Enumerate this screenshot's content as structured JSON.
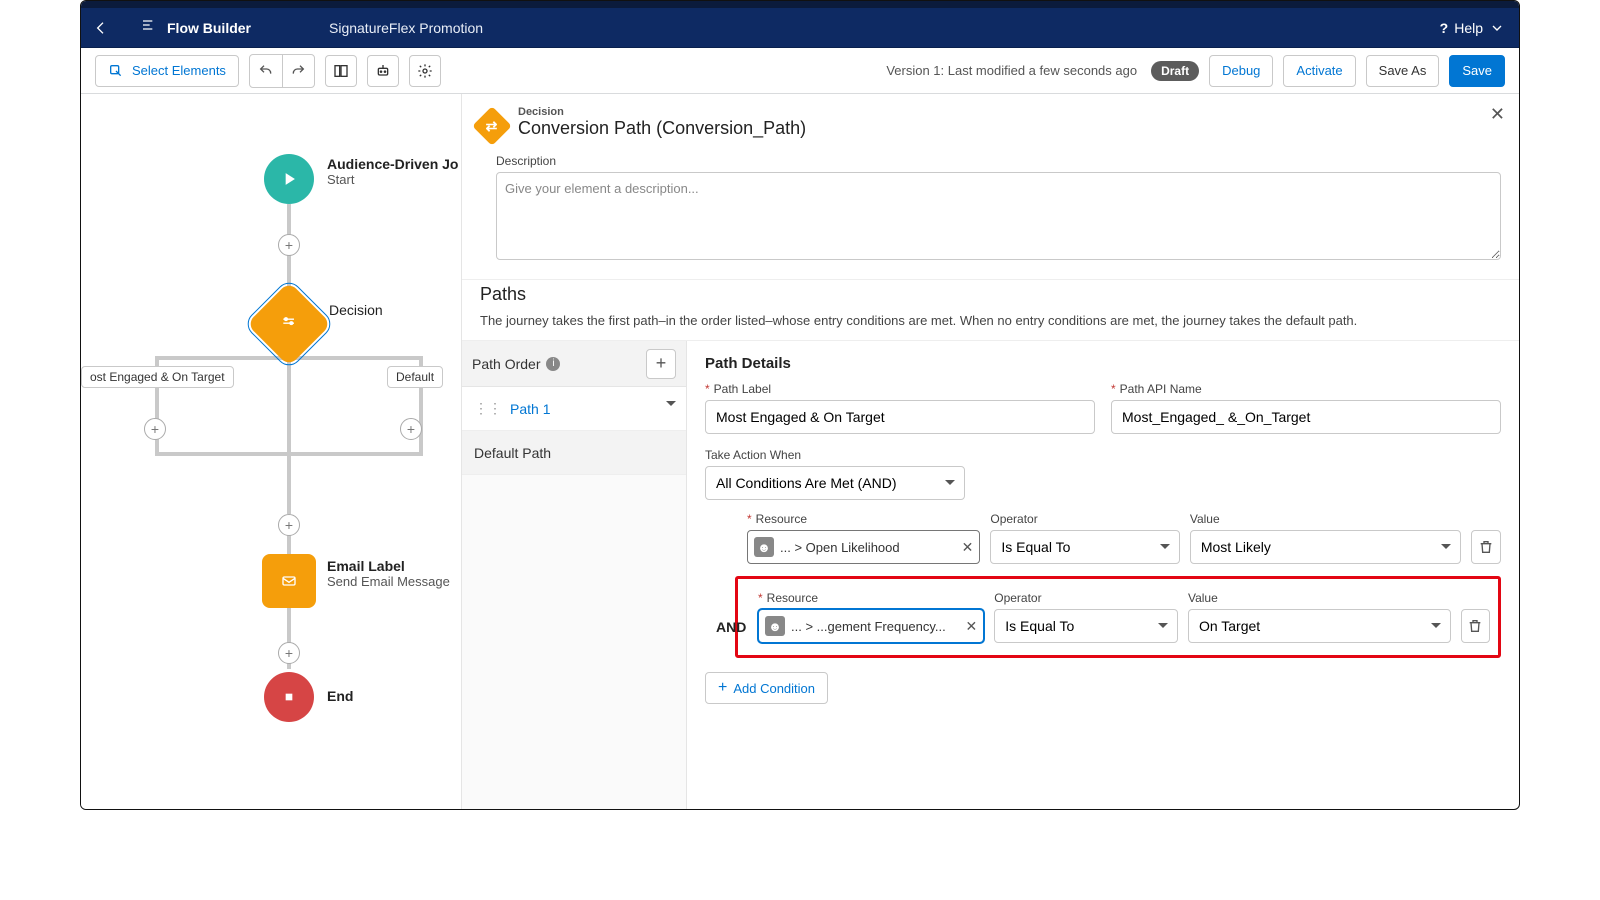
{
  "header": {
    "app": "Flow Builder",
    "flow_name": "SignatureFlex Promotion",
    "help": "Help"
  },
  "toolbar": {
    "select_elements": "Select Elements",
    "version_text": "Version 1: Last modified a few seconds ago",
    "status_pill": "Draft",
    "debug": "Debug",
    "activate": "Activate",
    "save_as": "Save As",
    "save": "Save"
  },
  "panel": {
    "eyebrow": "Decision",
    "title": "Conversion Path (Conversion_Path)",
    "description_label": "Description",
    "description_placeholder": "Give your element a description...",
    "paths_heading": "Paths",
    "paths_help": "The journey takes the first path–in the order listed–whose entry conditions are met. When no entry conditions are met, the journey takes the default path."
  },
  "order": {
    "title": "Path Order",
    "items": [
      "Path 1"
    ],
    "default": "Default Path"
  },
  "details": {
    "title": "Path Details",
    "path_label_label": "Path Label",
    "path_label_value": "Most Engaged & On Target",
    "api_name_label": "Path API Name",
    "api_name_value": "Most_Engaged_ &_On_Target",
    "take_action_label": "Take Action When",
    "take_action_value": "All Conditions Are Met (AND)",
    "resource_label": "Resource",
    "operator_label": "Operator",
    "value_label": "Value",
    "and": "AND",
    "add_condition": "Add Condition",
    "conditions": [
      {
        "resource": "... > Open Likelihood",
        "operator": "Is Equal To",
        "value": "Most Likely"
      },
      {
        "resource": "... > ...gement Frequency...",
        "operator": "Is Equal To",
        "value": "On Target"
      }
    ]
  },
  "canvas": {
    "start_title": "Audience-Driven Jo",
    "start_sub": "Start",
    "decision": "Decision",
    "branch_left": "ost Engaged & On Target",
    "branch_right": "Default",
    "email_title": "Email Label",
    "email_sub": "Send Email Message",
    "end": "End"
  }
}
